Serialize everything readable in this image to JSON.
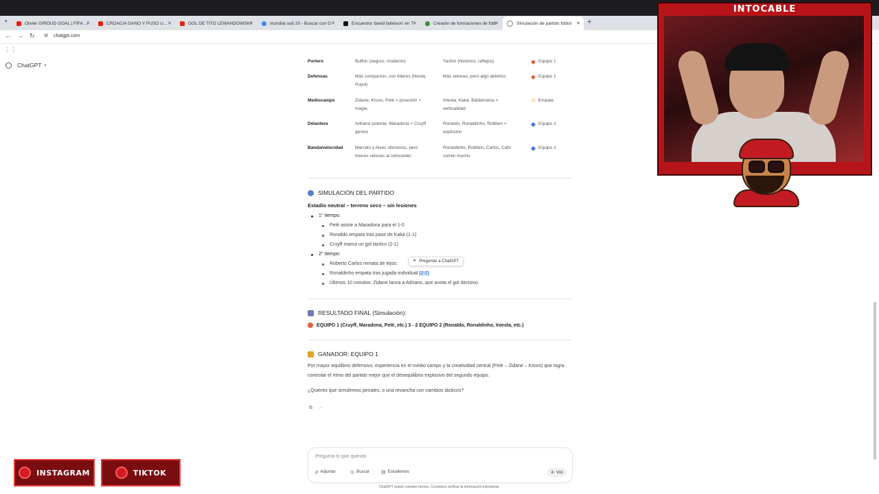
{
  "browser": {
    "tabs": [
      {
        "title": "Olivier GIROUD GOAL | FIFA PU",
        "favicon_color": "#e62117"
      },
      {
        "title": "CROACIA GANÓ Y PUSO UN PI",
        "favicon_color": "#e62117"
      },
      {
        "title": "GOL DE TITO LEWANDOWSKI",
        "favicon_color": "#e62117"
      },
      {
        "title": "mundial sub 20 - Buscar con G",
        "favicon_color": "#4285f4"
      },
      {
        "title": "Encuentra 'david faitelson' en T",
        "favicon_color": "#111111"
      },
      {
        "title": "Creador de formaciones de fútb",
        "favicon_color": "#3a8f3a"
      },
      {
        "title": "Simulación de partido fútbol",
        "favicon_color": "#777777"
      }
    ],
    "new_tab": "+",
    "url": "chatgpt.com"
  },
  "sidebar": {
    "brand": "ChatGPT"
  },
  "comparison_table": {
    "rows": [
      {
        "line": "Portero",
        "team1": "Buffon (seguro, moderno)",
        "team2": "Yashin (histórico, reflejos)",
        "winner": "Equipo 1",
        "winner_color": "#e0643a"
      },
      {
        "line": "Defensas",
        "team1": "Más compactos, con líderes (Nesta, Puyol)",
        "team2": "Más veloces, pero algo abiertos",
        "winner": "Equipo 1",
        "winner_color": "#e0643a"
      },
      {
        "line": "Mediocampo",
        "team1": "Zidane, Kroos, Pelé = posesión + magia",
        "team2": "Iniesta, Kaká, Balderrama = verticalidad",
        "winner": "Empate",
        "winner_color": "#e8a23a"
      },
      {
        "line": "Delantera",
        "team1": "Adriano potente, Maradona + Cruyff genios",
        "team2": "Ronaldo, Ronaldinho, Robben = explosión",
        "winner": "Equipo 2",
        "winner_color": "#3a78d8"
      },
      {
        "line": "Banda/velocidad",
        "team1": "Marcelo y Alves ofensivos, pero menos veloces al retroceder",
        "team2": "Ronaldinho, Robben, Carlos, Cafú corren mucho",
        "winner": "Equipo 2",
        "winner_color": "#3a78d8"
      }
    ]
  },
  "simulation": {
    "heading": "SIMULACIÓN DEL PARTIDO",
    "subtitle": "Estadio neutral – terreno seco – sin lesiones",
    "first_half_label": "1° tiempo:",
    "first_half": [
      "Pelé asiste a Maradona para el 1-0",
      "Ronaldo empata tras pase de Kaká (1-1)",
      "Cruyff marca un gol táctico (2-1)"
    ],
    "second_half_label": "2° tiempo:",
    "second_half_1": "Roberto Carlos remata de lejos:",
    "second_half_2_prefix": "Ronaldinho empata tras jugada individual ",
    "second_half_2_score": "(2-2)",
    "second_half_3": "Últimos 10 minutos: Zidane lanza a Adriano, que anota el gol decisivo",
    "tooltip": "Preguntar a ChatGPT"
  },
  "result": {
    "heading": "RESULTADO FINAL (Simulación):",
    "line": "EQUIPO 1 (Cruyff, Maradona, Pelé, etc.) 3 - 2 EQUIPO 2 (Ronaldo, Ronaldinho, Iniesta, etc.)"
  },
  "winner": {
    "heading": "GANADOR: EQUIPO 1",
    "paragraph": "Por mayor equilibrio defensivo, experiencia en el medio campo y la creatividad central (Pelé – Zidane – Kroos) que logra controlar el ritmo del partido mejor que el desequilibrio explosivo del segundo equipo.",
    "question": "¿Quieres que simulemos penales, o una revancha con cambios tácticos?"
  },
  "actions": {
    "copy_icon": "copy-icon",
    "more": "···"
  },
  "composer": {
    "placeholder": "Pregunta lo que quieras",
    "attach": "Adjuntar",
    "search": "Buscar",
    "study": "Estudiemos",
    "voice": "Voz"
  },
  "footer": "ChatGPT puede cometer errores. Considera verificar la información importante.",
  "stream_overlay": {
    "title": "INTOCABLE",
    "instagram": "INSTAGRAM",
    "tiktok": "TIKTOK"
  }
}
